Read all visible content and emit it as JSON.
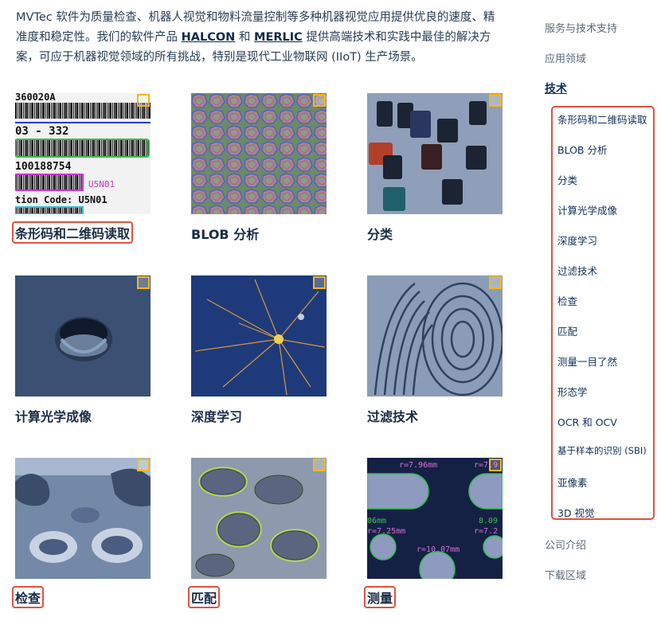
{
  "intro": {
    "part1": "MVTec 软件为质量检查、机器人视觉和物料流量控制等多种机器视觉应用提供优良的速度、精准度和稳定性。我们的软件产品 ",
    "link1": "HALCON",
    "part2": " 和 ",
    "link2": "MERLIC",
    "part3": " 提供高端技术和实践中最佳的解决方案，可应于机器视觉领域的所有挑战，特别是现代工业物联网 (IIoT) 生产场景。"
  },
  "tiles": [
    {
      "caption": "条形码和二维码读取",
      "highlighted": true,
      "icon": "barcode-image"
    },
    {
      "caption": "BLOB 分析",
      "highlighted": false,
      "icon": "blob-image"
    },
    {
      "caption": "分类",
      "highlighted": false,
      "icon": "classification-image"
    },
    {
      "caption": "计算光学成像",
      "highlighted": false,
      "icon": "computational-imaging-image"
    },
    {
      "caption": "深度学习",
      "highlighted": false,
      "icon": "deep-learning-image"
    },
    {
      "caption": "过滤技术",
      "highlighted": false,
      "icon": "filtering-image"
    },
    {
      "caption": "检查",
      "highlighted": true,
      "icon": "inspection-image"
    },
    {
      "caption": "匹配",
      "highlighted": true,
      "icon": "matching-image"
    },
    {
      "caption": "测量",
      "highlighted": true,
      "icon": "measuring-image"
    }
  ],
  "barcode_text": {
    "line1": "360020A",
    "line2": "03 - 332",
    "line3": "100188754",
    "line4": "U5N01",
    "line5": "tion Code: U5N01"
  },
  "measure_text": {
    "r1": "r=7.96mm",
    "r2": "r=7.9",
    "d1": "06mm",
    "d2": "8.09",
    "r3": "r=7.25mm",
    "r4": "r=7.2",
    "r5": "r=10.07mm"
  },
  "sidebar": {
    "items_top": [
      "服务与技术支持",
      "应用领域"
    ],
    "active": "技术",
    "sub_items": [
      "条形码和二维码读取",
      "BLOB 分析",
      "分类",
      "计算光学成像",
      "深度学习",
      "过滤技术",
      "检查",
      "匹配",
      "测量一目了然",
      "形态学",
      "OCR 和 OCV",
      "基于样本的识别 (SBI)",
      "亚像素",
      "3D 视觉"
    ],
    "items_bottom": [
      "公司介绍",
      "下载区域"
    ]
  },
  "colors": {
    "highlight": "#e0523f",
    "badge": "#f5b915",
    "link": "#13305a"
  }
}
